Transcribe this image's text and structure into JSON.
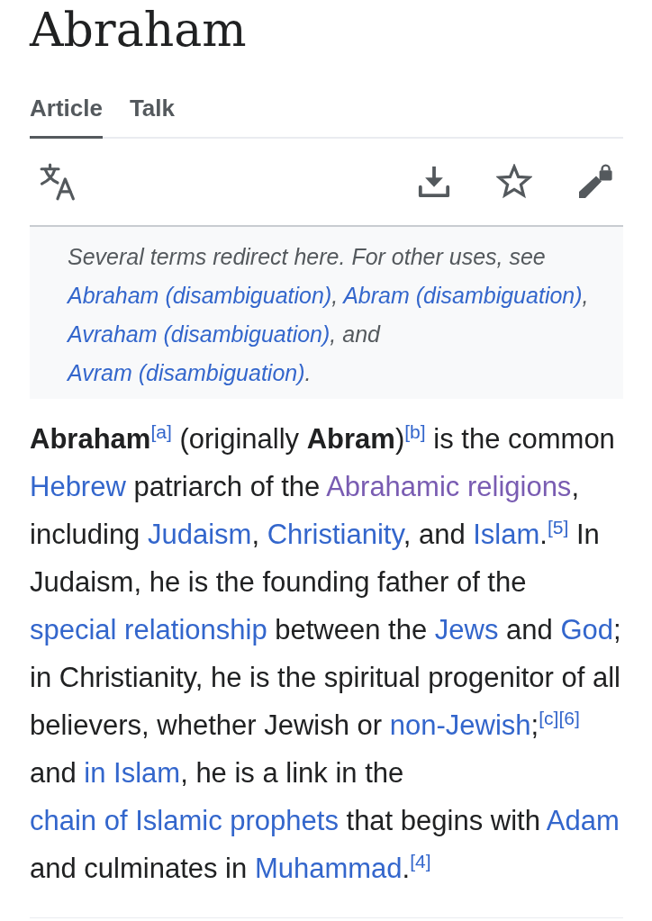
{
  "title": "Abraham",
  "tabs": [
    {
      "label": "Article",
      "selected": true
    },
    {
      "label": "Talk",
      "selected": false
    }
  ],
  "hatnote": {
    "runs": [
      {
        "kind": "text",
        "text": "Several terms redirect here. For other uses, see "
      },
      {
        "kind": "link",
        "text": "Abraham (disambiguation)",
        "visited": false
      },
      {
        "kind": "text",
        "text": ", "
      },
      {
        "kind": "link",
        "text": "Abram (disambiguation)",
        "visited": false
      },
      {
        "kind": "text",
        "text": ", "
      },
      {
        "kind": "link",
        "text": "Avraham (disambiguation)",
        "visited": false
      },
      {
        "kind": "text",
        "text": ", and "
      },
      {
        "kind": "link",
        "text": "Avram (disambiguation)",
        "visited": false
      },
      {
        "kind": "text",
        "text": "."
      }
    ]
  },
  "paragraph": {
    "runs": [
      {
        "kind": "text",
        "text": "**Abraham**"
      },
      {
        "kind": "ref",
        "text": "[a]",
        "visited": false
      },
      {
        "kind": "text",
        "text": " (originally **Abram**)"
      },
      {
        "kind": "ref",
        "text": "[b]",
        "visited": false
      },
      {
        "kind": "text",
        "text": " is the common "
      },
      {
        "kind": "link",
        "text": "Hebrew",
        "visited": false
      },
      {
        "kind": "text",
        "text": " patriarch of the "
      },
      {
        "kind": "link",
        "text": "Abrahamic religions",
        "visited": true
      },
      {
        "kind": "text",
        "text": ", including "
      },
      {
        "kind": "link",
        "text": "Judaism",
        "visited": false
      },
      {
        "kind": "text",
        "text": ", "
      },
      {
        "kind": "link",
        "text": "Christianity",
        "visited": false
      },
      {
        "kind": "text",
        "text": ", and "
      },
      {
        "kind": "link",
        "text": "Islam",
        "visited": false
      },
      {
        "kind": "text",
        "text": "."
      },
      {
        "kind": "ref",
        "text": "[5]",
        "visited": false
      },
      {
        "kind": "text",
        "text": " In Judaism, he is the founding father of the "
      },
      {
        "kind": "link",
        "text": "special relationship",
        "visited": false
      },
      {
        "kind": "text",
        "text": " between the "
      },
      {
        "kind": "link",
        "text": "Jews",
        "visited": false
      },
      {
        "kind": "text",
        "text": " and "
      },
      {
        "kind": "link",
        "text": "God",
        "visited": false
      },
      {
        "kind": "text",
        "text": "; in Christianity, he is the spiritual progenitor of all believers, whether Jewish or "
      },
      {
        "kind": "link",
        "text": "non-Jewish",
        "visited": false
      },
      {
        "kind": "text",
        "text": ";"
      },
      {
        "kind": "ref",
        "text": "[c]",
        "visited": false
      },
      {
        "kind": "ref",
        "text": "[6]",
        "visited": false
      },
      {
        "kind": "text",
        "text": " and "
      },
      {
        "kind": "link",
        "text": "in Islam",
        "visited": false
      },
      {
        "kind": "text",
        "text": ", he is a link in the "
      },
      {
        "kind": "link",
        "text": "chain of Islamic prophets",
        "visited": false
      },
      {
        "kind": "text",
        "text": " that begins with "
      },
      {
        "kind": "link",
        "text": "Adam",
        "visited": false
      },
      {
        "kind": "text",
        "text": " and culminates in "
      },
      {
        "kind": "link",
        "text": "Muhammad",
        "visited": false
      },
      {
        "kind": "text",
        "text": "."
      },
      {
        "kind": "ref",
        "text": "[4]",
        "visited": false
      }
    ]
  }
}
